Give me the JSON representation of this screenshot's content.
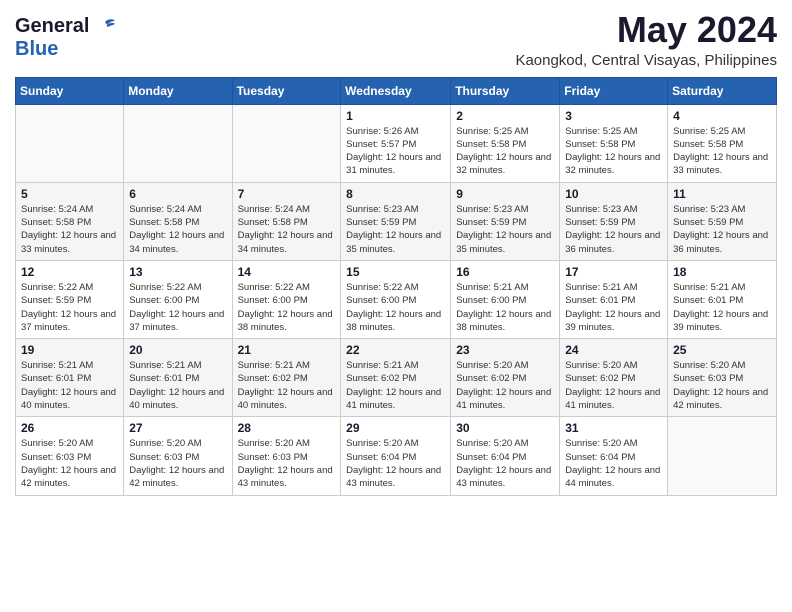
{
  "logo": {
    "general": "General",
    "blue": "Blue"
  },
  "title": "May 2024",
  "location": "Kaongkod, Central Visayas, Philippines",
  "days_header": [
    "Sunday",
    "Monday",
    "Tuesday",
    "Wednesday",
    "Thursday",
    "Friday",
    "Saturday"
  ],
  "weeks": [
    [
      {
        "day": "",
        "info": ""
      },
      {
        "day": "",
        "info": ""
      },
      {
        "day": "",
        "info": ""
      },
      {
        "day": "1",
        "sunrise": "5:26 AM",
        "sunset": "5:57 PM",
        "daylight": "12 hours and 31 minutes."
      },
      {
        "day": "2",
        "sunrise": "5:25 AM",
        "sunset": "5:58 PM",
        "daylight": "12 hours and 32 minutes."
      },
      {
        "day": "3",
        "sunrise": "5:25 AM",
        "sunset": "5:58 PM",
        "daylight": "12 hours and 32 minutes."
      },
      {
        "day": "4",
        "sunrise": "5:25 AM",
        "sunset": "5:58 PM",
        "daylight": "12 hours and 33 minutes."
      }
    ],
    [
      {
        "day": "5",
        "sunrise": "5:24 AM",
        "sunset": "5:58 PM",
        "daylight": "12 hours and 33 minutes."
      },
      {
        "day": "6",
        "sunrise": "5:24 AM",
        "sunset": "5:58 PM",
        "daylight": "12 hours and 34 minutes."
      },
      {
        "day": "7",
        "sunrise": "5:24 AM",
        "sunset": "5:58 PM",
        "daylight": "12 hours and 34 minutes."
      },
      {
        "day": "8",
        "sunrise": "5:23 AM",
        "sunset": "5:59 PM",
        "daylight": "12 hours and 35 minutes."
      },
      {
        "day": "9",
        "sunrise": "5:23 AM",
        "sunset": "5:59 PM",
        "daylight": "12 hours and 35 minutes."
      },
      {
        "day": "10",
        "sunrise": "5:23 AM",
        "sunset": "5:59 PM",
        "daylight": "12 hours and 36 minutes."
      },
      {
        "day": "11",
        "sunrise": "5:23 AM",
        "sunset": "5:59 PM",
        "daylight": "12 hours and 36 minutes."
      }
    ],
    [
      {
        "day": "12",
        "sunrise": "5:22 AM",
        "sunset": "5:59 PM",
        "daylight": "12 hours and 37 minutes."
      },
      {
        "day": "13",
        "sunrise": "5:22 AM",
        "sunset": "6:00 PM",
        "daylight": "12 hours and 37 minutes."
      },
      {
        "day": "14",
        "sunrise": "5:22 AM",
        "sunset": "6:00 PM",
        "daylight": "12 hours and 38 minutes."
      },
      {
        "day": "15",
        "sunrise": "5:22 AM",
        "sunset": "6:00 PM",
        "daylight": "12 hours and 38 minutes."
      },
      {
        "day": "16",
        "sunrise": "5:21 AM",
        "sunset": "6:00 PM",
        "daylight": "12 hours and 38 minutes."
      },
      {
        "day": "17",
        "sunrise": "5:21 AM",
        "sunset": "6:01 PM",
        "daylight": "12 hours and 39 minutes."
      },
      {
        "day": "18",
        "sunrise": "5:21 AM",
        "sunset": "6:01 PM",
        "daylight": "12 hours and 39 minutes."
      }
    ],
    [
      {
        "day": "19",
        "sunrise": "5:21 AM",
        "sunset": "6:01 PM",
        "daylight": "12 hours and 40 minutes."
      },
      {
        "day": "20",
        "sunrise": "5:21 AM",
        "sunset": "6:01 PM",
        "daylight": "12 hours and 40 minutes."
      },
      {
        "day": "21",
        "sunrise": "5:21 AM",
        "sunset": "6:02 PM",
        "daylight": "12 hours and 40 minutes."
      },
      {
        "day": "22",
        "sunrise": "5:21 AM",
        "sunset": "6:02 PM",
        "daylight": "12 hours and 41 minutes."
      },
      {
        "day": "23",
        "sunrise": "5:20 AM",
        "sunset": "6:02 PM",
        "daylight": "12 hours and 41 minutes."
      },
      {
        "day": "24",
        "sunrise": "5:20 AM",
        "sunset": "6:02 PM",
        "daylight": "12 hours and 41 minutes."
      },
      {
        "day": "25",
        "sunrise": "5:20 AM",
        "sunset": "6:03 PM",
        "daylight": "12 hours and 42 minutes."
      }
    ],
    [
      {
        "day": "26",
        "sunrise": "5:20 AM",
        "sunset": "6:03 PM",
        "daylight": "12 hours and 42 minutes."
      },
      {
        "day": "27",
        "sunrise": "5:20 AM",
        "sunset": "6:03 PM",
        "daylight": "12 hours and 42 minutes."
      },
      {
        "day": "28",
        "sunrise": "5:20 AM",
        "sunset": "6:03 PM",
        "daylight": "12 hours and 43 minutes."
      },
      {
        "day": "29",
        "sunrise": "5:20 AM",
        "sunset": "6:04 PM",
        "daylight": "12 hours and 43 minutes."
      },
      {
        "day": "30",
        "sunrise": "5:20 AM",
        "sunset": "6:04 PM",
        "daylight": "12 hours and 43 minutes."
      },
      {
        "day": "31",
        "sunrise": "5:20 AM",
        "sunset": "6:04 PM",
        "daylight": "12 hours and 44 minutes."
      },
      {
        "day": "",
        "info": ""
      }
    ]
  ],
  "labels": {
    "sunrise_prefix": "Sunrise: ",
    "sunset_prefix": "Sunset: ",
    "daylight_prefix": "Daylight: "
  }
}
